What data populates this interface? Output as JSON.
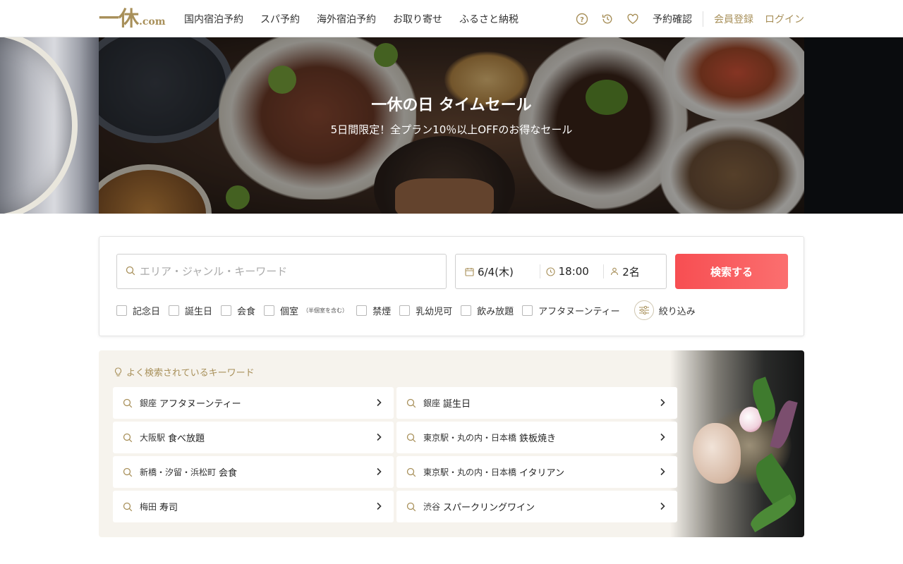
{
  "logo": {
    "kanji": "一休",
    "suffix": ".com"
  },
  "nav": {
    "items": [
      "国内宿泊予約",
      "スパ予約",
      "海外宿泊予約",
      "お取り寄せ",
      "ふるさと納税"
    ]
  },
  "utility": {
    "icons": [
      "help-icon",
      "history-icon",
      "heart-icon"
    ],
    "reservation_check": "予約確認",
    "register": "会員登録",
    "login": "ログイン",
    "accent_color": "#a8905a"
  },
  "hero": {
    "title": "一休の日 タイムセール",
    "subtitle": "5日間限定！全プラン10％以上OFFのお得なセール"
  },
  "search": {
    "keyword_placeholder": "エリア・ジャンル・キーワード",
    "date": "6/4(木)",
    "time": "18:00",
    "guests": "2名",
    "button_label": "検索する",
    "button_color": "#f74e52",
    "checkboxes": [
      {
        "label": "記念日",
        "note": "",
        "checked": false
      },
      {
        "label": "誕生日",
        "note": "",
        "checked": false
      },
      {
        "label": "会食",
        "note": "",
        "checked": false
      },
      {
        "label": "個室",
        "note": "（半個室を含む）",
        "checked": false
      },
      {
        "label": "禁煙",
        "note": "",
        "checked": false
      },
      {
        "label": "乳幼児可",
        "note": "",
        "checked": false
      },
      {
        "label": "飲み放題",
        "note": "",
        "checked": false
      },
      {
        "label": "アフタヌーンティー",
        "note": "",
        "checked": false
      }
    ],
    "filter_label": "絞り込み"
  },
  "popular": {
    "heading": "よく検索されているキーワード",
    "items": [
      {
        "area": "銀座",
        "term": "アフタヌーンティー"
      },
      {
        "area": "銀座",
        "term": "誕生日"
      },
      {
        "area": "大阪駅",
        "term": "食べ放題"
      },
      {
        "area": "東京駅・丸の内・日本橋",
        "term": "鉄板焼き"
      },
      {
        "area": "新橋・汐留・浜松町",
        "term": "会食"
      },
      {
        "area": "東京駅・丸の内・日本橋",
        "term": "イタリアン"
      },
      {
        "area": "梅田",
        "term": "寿司"
      },
      {
        "area": "渋谷",
        "term": "スパークリングワイン"
      }
    ]
  }
}
